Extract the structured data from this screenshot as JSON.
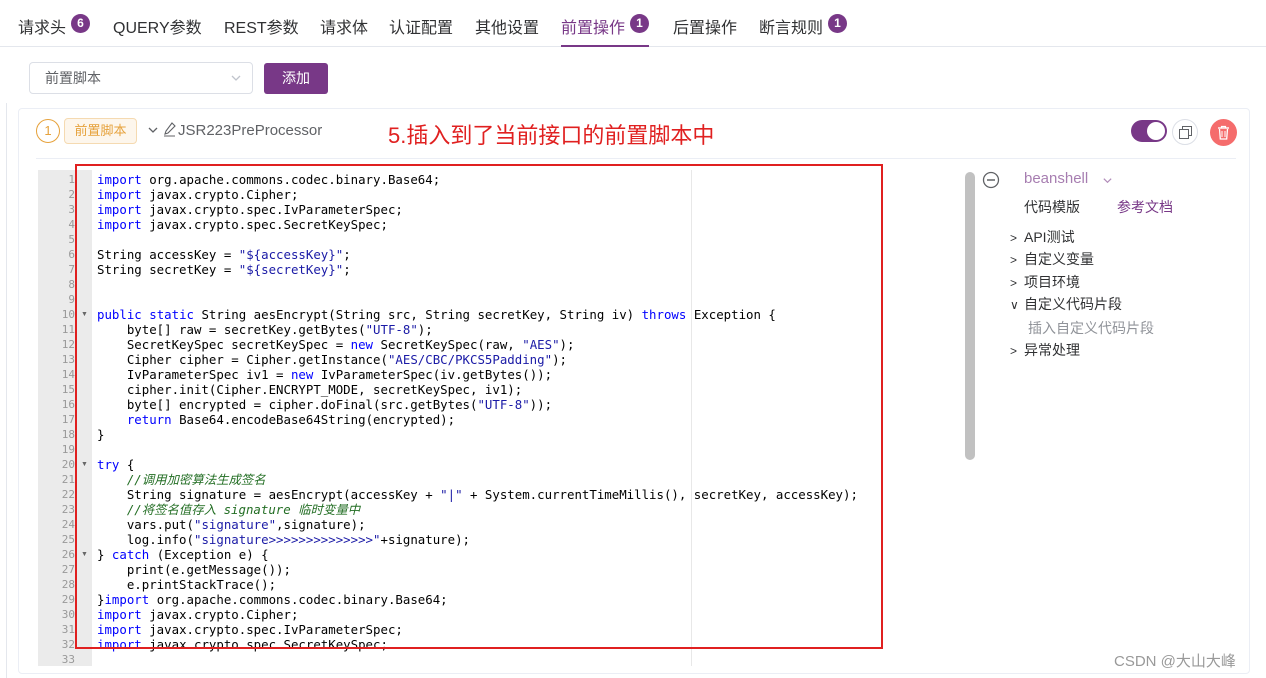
{
  "tabs": [
    {
      "label": "请求头",
      "badge": "6"
    },
    {
      "label": "QUERY参数",
      "badge": ""
    },
    {
      "label": "REST参数",
      "badge": ""
    },
    {
      "label": "请求体",
      "badge": ""
    },
    {
      "label": "认证配置",
      "badge": ""
    },
    {
      "label": "其他设置",
      "badge": ""
    },
    {
      "label": "前置操作",
      "badge": "1"
    },
    {
      "label": "后置操作",
      "badge": ""
    },
    {
      "label": "断言规则",
      "badge": "1"
    }
  ],
  "active_tab": "前置操作",
  "toolbar": {
    "select_value": "前置脚本",
    "add_label": "添加"
  },
  "step": {
    "index": "1",
    "type_tag": "前置脚本",
    "name": "JSR223PreProcessor",
    "annotation": "5.插入到了当前接口的前置脚本中",
    "enabled": true
  },
  "editor": {
    "line_numbers": [
      "1",
      "2",
      "3",
      "4",
      "5",
      "6",
      "7",
      "8",
      "9",
      "10",
      "11",
      "12",
      "13",
      "14",
      "15",
      "16",
      "17",
      "18",
      "19",
      "20",
      "21",
      "22",
      "23",
      "24",
      "25",
      "26",
      "27",
      "28",
      "29",
      "30",
      "31",
      "32",
      "33"
    ],
    "fold_lines": [
      "10",
      "20",
      "26"
    ],
    "code_lines": [
      "import org.apache.commons.codec.binary.Base64;",
      "import javax.crypto.Cipher;",
      "import javax.crypto.spec.IvParameterSpec;",
      "import javax.crypto.spec.SecretKeySpec;",
      "",
      "String accessKey = \"${accessKey}\";",
      "String secretKey = \"${secretKey}\";",
      "",
      "",
      "public static String aesEncrypt(String src, String secretKey, String iv) throws Exception {",
      "    byte[] raw = secretKey.getBytes(\"UTF-8\");",
      "    SecretKeySpec secretKeySpec = new SecretKeySpec(raw, \"AES\");",
      "    Cipher cipher = Cipher.getInstance(\"AES/CBC/PKCS5Padding\");",
      "    IvParameterSpec iv1 = new IvParameterSpec(iv.getBytes());",
      "    cipher.init(Cipher.ENCRYPT_MODE, secretKeySpec, iv1);",
      "    byte[] encrypted = cipher.doFinal(src.getBytes(\"UTF-8\"));",
      "    return Base64.encodeBase64String(encrypted);",
      "}",
      "",
      "try {",
      "    //调用加密算法生成签名",
      "    String signature = aesEncrypt(accessKey + \"|\" + System.currentTimeMillis(), secretKey, accessKey);",
      "    //将签名值存入 signature 临时变量中",
      "    vars.put(\"signature\",signature);",
      "    log.info(\"signature>>>>>>>>>>>>>>\"+signature);",
      "} catch (Exception e) {",
      "    print(e.getMessage());",
      "    e.printStackTrace();",
      "}import org.apache.commons.codec.binary.Base64;",
      "import javax.crypto.Cipher;",
      "import javax.crypto.spec.IvParameterSpec;",
      "import javax.crypto.spec.SecretKeySpec;",
      ""
    ]
  },
  "side": {
    "language": "beanshell",
    "template_label": "代码模版",
    "doc_link": "参考文档",
    "tree": [
      {
        "label": "API测试",
        "expanded": false
      },
      {
        "label": "自定义变量",
        "expanded": false
      },
      {
        "label": "项目环境",
        "expanded": false
      },
      {
        "label": "自定义代码片段",
        "expanded": true
      },
      {
        "label": "异常处理",
        "expanded": false
      }
    ],
    "sub_item": "插入自定义代码片段"
  },
  "watermark": "CSDN @大山大峰",
  "colors": {
    "accent": "#783887",
    "warning": "#e6a23c",
    "danger": "#f56c6c",
    "annotation": "#e02020"
  }
}
